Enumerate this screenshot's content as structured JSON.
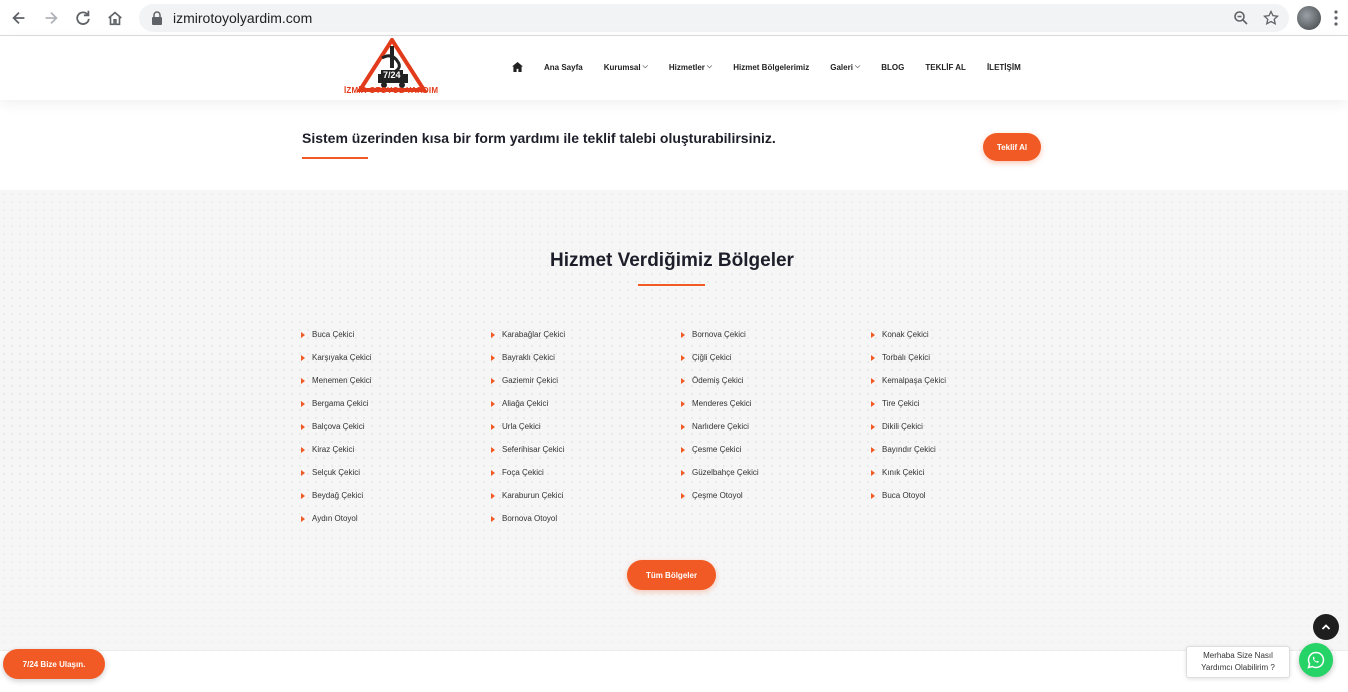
{
  "browser": {
    "url": "izmirotoyolyardim.com",
    "icons": [
      "back-icon",
      "forward-icon",
      "reload-icon",
      "home-icon",
      "lock-icon",
      "zoom-icon",
      "bookmark-star-icon",
      "profile-avatar",
      "menu-kebab-icon"
    ]
  },
  "header": {
    "logo_badge": "7/24",
    "logo_text": "İZMİR OTOYOL YARDIM",
    "menu": [
      {
        "label": "Ana Sayfa",
        "dropdown": false
      },
      {
        "label": "Kurumsal",
        "dropdown": true
      },
      {
        "label": "Hizmetler",
        "dropdown": true
      },
      {
        "label": "Hizmet Bölgelerimiz",
        "dropdown": false
      },
      {
        "label": "Galeri",
        "dropdown": true
      },
      {
        "label": "BLOG",
        "dropdown": false
      },
      {
        "label": "TEKLİF AL",
        "dropdown": false
      },
      {
        "label": "İLETİŞİM",
        "dropdown": false
      }
    ]
  },
  "cta": {
    "text": "Sistem üzerinden kısa bir form yardımı ile teklif talebi oluşturabilirsiniz.",
    "button": "Teklif Al"
  },
  "regions": {
    "title": "Hizmet Verdiğimiz Bölgeler",
    "columns": [
      [
        "Buca Çekici",
        "Karşıyaka Çekici",
        "Menemen Çekici",
        "Bergama Çekici",
        "Balçova Çekici",
        "Kiraz Çekici",
        "Selçuk Çekici",
        "Beydağ Çekici",
        "Aydın Otoyol"
      ],
      [
        "Karabağlar Çekici",
        "Bayraklı Çekici",
        "Gaziemir Çekici",
        "Aliağa Çekici",
        "Urla Çekici",
        "Seferihisar Çekici",
        "Foça Çekici",
        "Karaburun Çekici",
        "Bornova Otoyol"
      ],
      [
        "Bornova Çekici",
        "Çiğli Çekici",
        "Ödemiş Çekici",
        "Menderes Çekici",
        "Narlıdere Çekici",
        "Çesme Çekici",
        "Güzelbahçe Çekici",
        "Çeşme Otoyol"
      ],
      [
        "Konak Çekici",
        "Torbalı Çekici",
        "Kemalpaşa Çekici",
        "Tire Çekici",
        "Dikili Çekici",
        "Bayındır Çekici",
        "Kınık Çekici",
        "Buca Otoyol"
      ]
    ],
    "all_button": "Tüm Bölgeler"
  },
  "floating": {
    "contact_button": "7/24 Bize Ulaşın.",
    "whatsapp_bubble_line1": "Merhaba Size Nasıl",
    "whatsapp_bubble_line2": "Yardımcı Olabilirim ?"
  },
  "colors": {
    "accent": "#f15a24",
    "whatsapp": "#25d366",
    "dark": "#1e1e2a"
  }
}
